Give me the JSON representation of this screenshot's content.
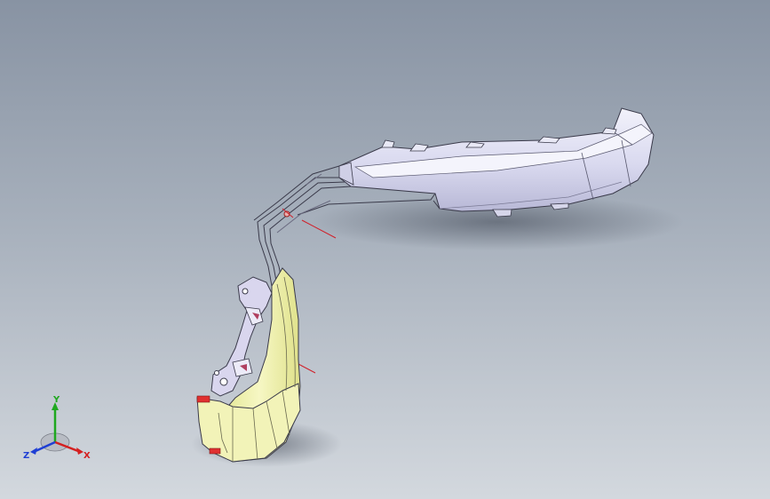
{
  "viewport": {
    "background_top": "#8893a3",
    "background_bottom": "#d3d8de"
  },
  "model": {
    "part_upper_color": "#ddddf0",
    "part_lower_color": "#eef0a8",
    "edge_color": "#3a3a4a",
    "reference_axis_color": "#d0202a"
  },
  "triad": {
    "y_label": "Y",
    "x_label": "X",
    "z_label": "Z",
    "y_color": "#1fa81f",
    "x_color": "#d42020",
    "z_color": "#1f3fd4"
  }
}
